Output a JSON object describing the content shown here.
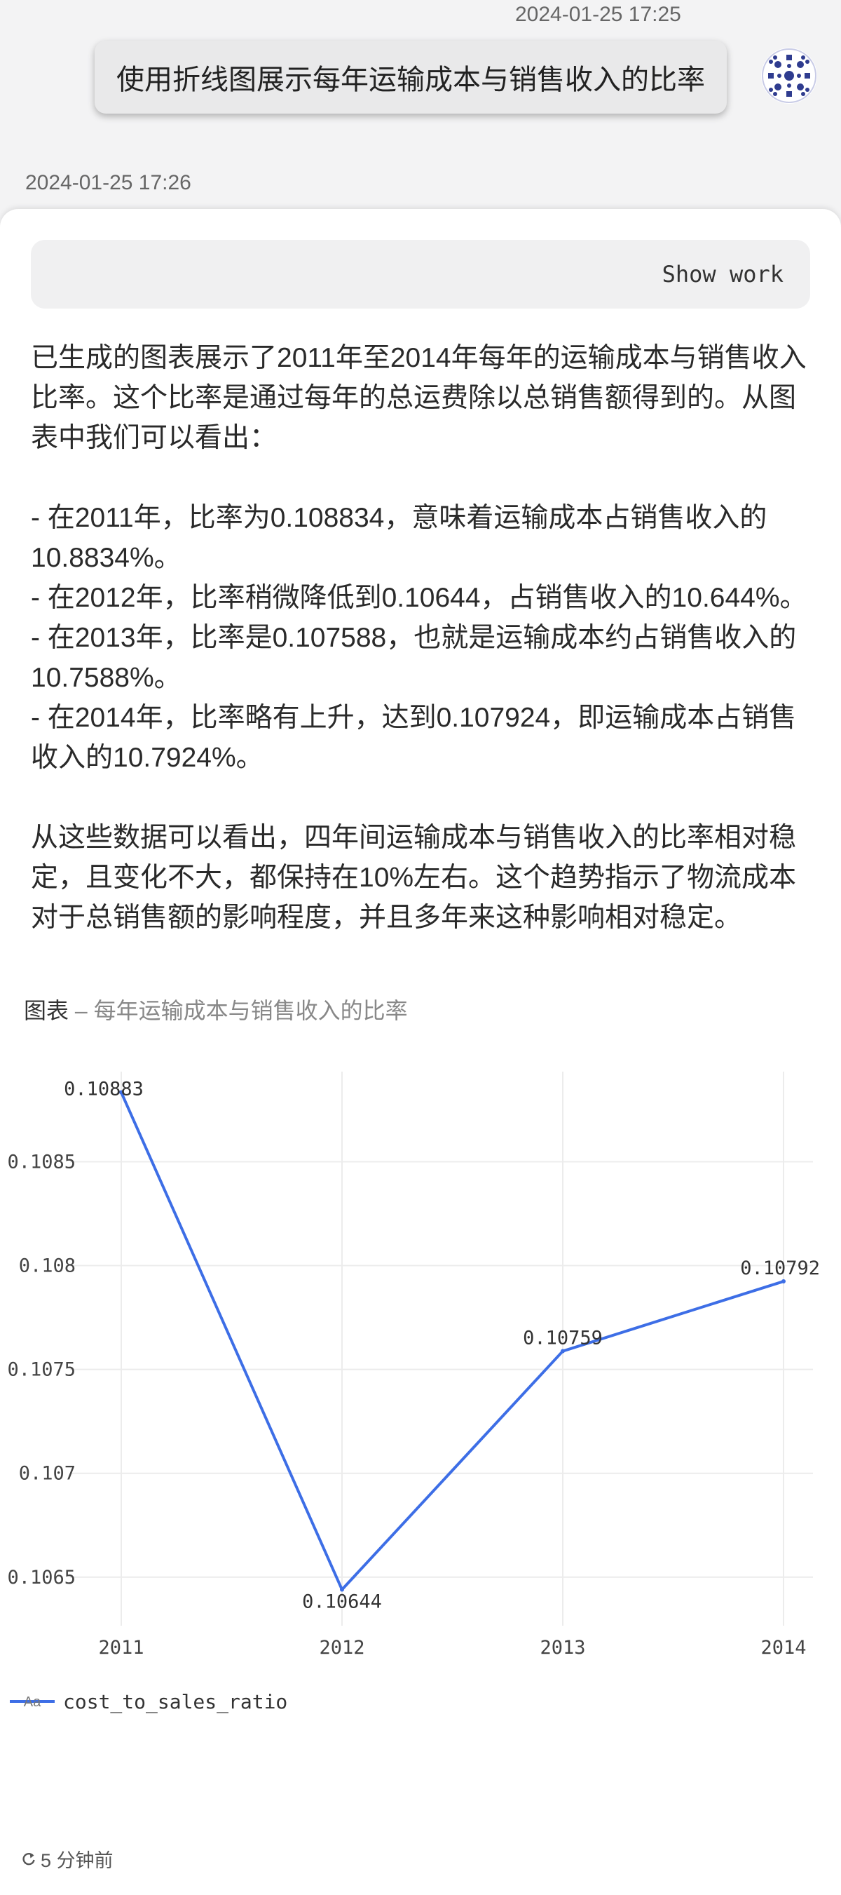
{
  "header": {
    "user_timestamp": "2024-01-25 17:25",
    "user_message": "使用折线图展示每年运输成本与销售收入的比率",
    "bot_timestamp": "2024-01-25 17:26"
  },
  "response": {
    "show_work_label": "Show work",
    "intro": "已生成的图表展示了2011年至2014年每年的运输成本与销售收入比率。这个比率是通过每年的总运费除以总销售额得到的。从图表中我们可以看出：",
    "bullets": [
      "- 在2011年，比率为0.108834，意味着运输成本占销售收入的10.8834%。",
      "- 在2012年，比率稍微降低到0.10644，占销售收入的10.644%。",
      "- 在2013年，比率是0.107588，也就是运输成本约占销售收入的10.7588%。",
      "- 在2014年，比率略有上升，达到0.107924，即运输成本占销售收入的10.7924%。"
    ],
    "conclusion": "从这些数据可以看出，四年间运输成本与销售收入的比率相对稳定，且变化不大，都保持在10%左右。这个趋势指示了物流成本对于总销售额的影响程度，并且多年来这种影响相对稳定。"
  },
  "chart_section": {
    "label": "图表",
    "separator": " – ",
    "title": "每年运输成本与销售收入的比率"
  },
  "chart_data": {
    "type": "line",
    "x": [
      "2011",
      "2012",
      "2013",
      "2014"
    ],
    "series": [
      {
        "name": "cost_to_sales_ratio",
        "values": [
          0.108834,
          0.10644,
          0.107588,
          0.107924
        ],
        "labels": [
          "0.10883",
          "0.10644",
          "0.10759",
          "0.10792"
        ],
        "color": "#3d6ee6"
      }
    ],
    "yticks": [
      "0.1065",
      "0.107",
      "0.1075",
      "0.108",
      "0.1085"
    ],
    "ylim": [
      0.1063,
      0.1089
    ],
    "grid": true,
    "legend_position": "bottom-left",
    "legend_icon": "Aa"
  },
  "footer": {
    "refresh_icon": "refresh-icon",
    "time_ago": "5 分钟前"
  }
}
